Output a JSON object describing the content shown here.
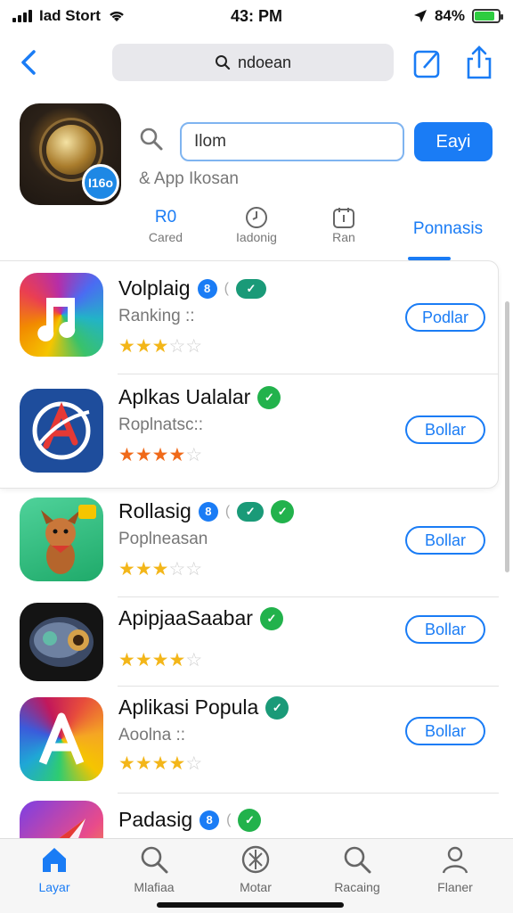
{
  "status_bar": {
    "carrier": "Iad Stort",
    "time": "43: PM",
    "battery": "84%",
    "battery_level": 0.84
  },
  "nav": {
    "search_text": "ndoean"
  },
  "header": {
    "feature_badge": "I16o",
    "search_value": "Ilom",
    "search_button": "Eayi",
    "subtitle": "& App Ikosan"
  },
  "tabs": [
    {
      "top": "R0",
      "label": "Cared"
    },
    {
      "top": "",
      "label": "Iadonig"
    },
    {
      "top": "",
      "label": "Ran"
    },
    {
      "top": "",
      "label": "Ponnasis"
    }
  ],
  "apps": [
    {
      "name": "Volplaig",
      "subtitle": "Ranking ::",
      "rating": 3,
      "button": "Podlar",
      "chips": [
        "blue",
        "teal"
      ],
      "chip_text": "8"
    },
    {
      "name": "Aplkas Ualalar",
      "subtitle": "Roplnatsc::",
      "rating": 4,
      "button": "Bollar",
      "chips": [
        "green"
      ],
      "chip_text": ""
    },
    {
      "name": "Rollasig",
      "subtitle": "Poplneasan",
      "rating": 3,
      "button": "Bollar",
      "chips": [
        "blue",
        "teal",
        "green"
      ],
      "chip_text": "8"
    },
    {
      "name": "ApipjaaSaabar",
      "subtitle": "",
      "rating": 4,
      "button": "Bollar",
      "chips": [
        "green"
      ],
      "chip_text": ""
    },
    {
      "name": "Aplikasi Popula",
      "subtitle": "Aoolna ::",
      "rating": 4,
      "button": "Bollar",
      "chips": [
        "green"
      ],
      "chip_text": ""
    },
    {
      "name": "Padasig",
      "subtitle": "",
      "rating": 0,
      "button": "",
      "chips": [
        "blue",
        "green"
      ],
      "chip_text": "8"
    }
  ],
  "tab_bar": [
    {
      "label": "Layar",
      "icon": "home-icon"
    },
    {
      "label": "Mlafiaa",
      "icon": "search-icon"
    },
    {
      "label": "Motar",
      "icon": "compass-icon"
    },
    {
      "label": "Racaing",
      "icon": "search-icon"
    },
    {
      "label": "Flaner",
      "icon": "person-icon"
    }
  ],
  "colors": {
    "accent": "#1a7cf5",
    "star": "#f3b619",
    "verified": "#22b24c"
  }
}
